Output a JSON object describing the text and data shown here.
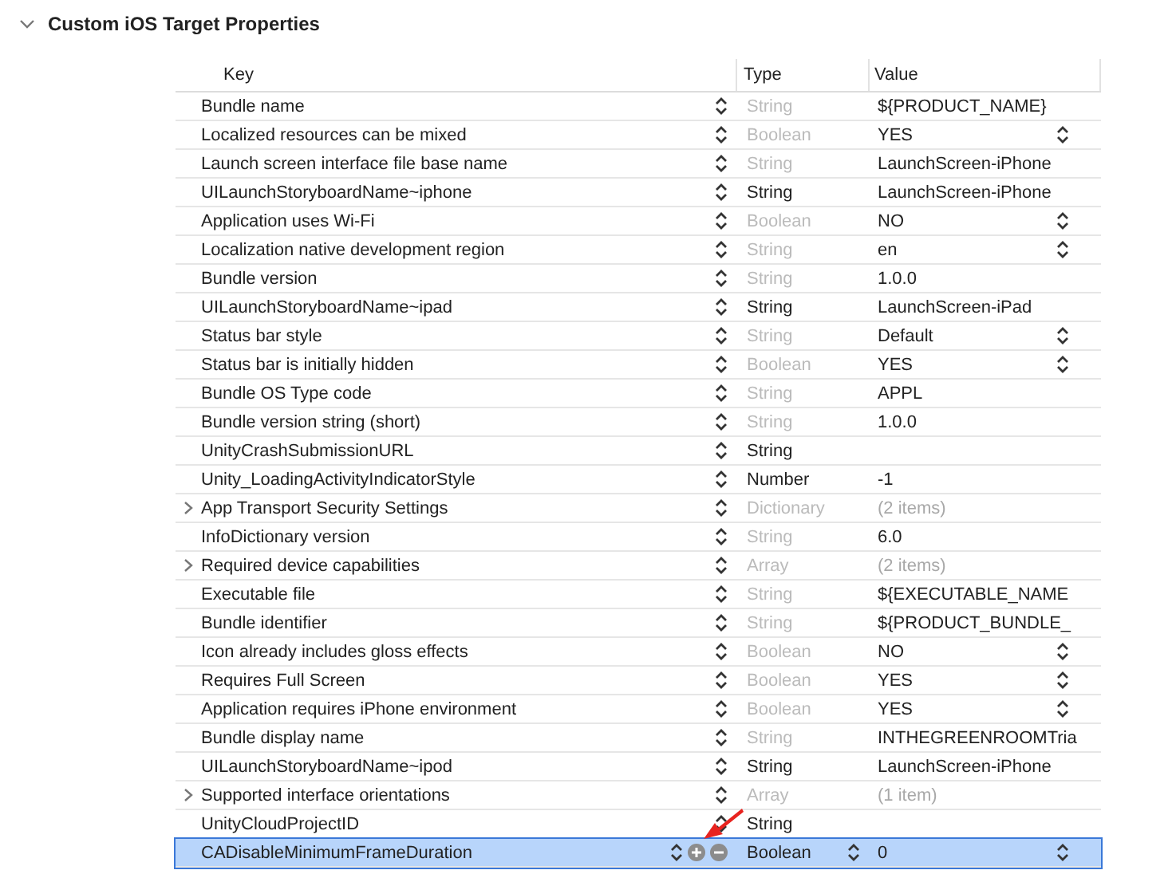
{
  "section": {
    "title": "Custom iOS Target Properties",
    "expanded": true
  },
  "columns": [
    "Key",
    "Type",
    "Value"
  ],
  "rows": [
    {
      "key": "Bundle name",
      "type": "String",
      "type_dimmed": true,
      "value": "${PRODUCT_NAME}",
      "value_dimmed": false,
      "value_popup": false,
      "expandable": false,
      "selected": false
    },
    {
      "key": "Localized resources can be mixed",
      "type": "Boolean",
      "type_dimmed": true,
      "value": "YES",
      "value_dimmed": false,
      "value_popup": true,
      "expandable": false,
      "selected": false
    },
    {
      "key": "Launch screen interface file base name",
      "type": "String",
      "type_dimmed": true,
      "value": "LaunchScreen-iPhone",
      "value_dimmed": false,
      "value_popup": false,
      "expandable": false,
      "selected": false
    },
    {
      "key": "UILaunchStoryboardName~iphone",
      "type": "String",
      "type_dimmed": false,
      "value": "LaunchScreen-iPhone",
      "value_dimmed": false,
      "value_popup": false,
      "expandable": false,
      "selected": false
    },
    {
      "key": "Application uses Wi-Fi",
      "type": "Boolean",
      "type_dimmed": true,
      "value": "NO",
      "value_dimmed": false,
      "value_popup": true,
      "expandable": false,
      "selected": false
    },
    {
      "key": "Localization native development region",
      "type": "String",
      "type_dimmed": true,
      "value": "en",
      "value_dimmed": false,
      "value_popup": true,
      "expandable": false,
      "selected": false
    },
    {
      "key": "Bundle version",
      "type": "String",
      "type_dimmed": true,
      "value": "1.0.0",
      "value_dimmed": false,
      "value_popup": false,
      "expandable": false,
      "selected": false
    },
    {
      "key": "UILaunchStoryboardName~ipad",
      "type": "String",
      "type_dimmed": false,
      "value": "LaunchScreen-iPad",
      "value_dimmed": false,
      "value_popup": false,
      "expandable": false,
      "selected": false
    },
    {
      "key": "Status bar style",
      "type": "String",
      "type_dimmed": true,
      "value": "Default",
      "value_dimmed": false,
      "value_popup": true,
      "expandable": false,
      "selected": false
    },
    {
      "key": "Status bar is initially hidden",
      "type": "Boolean",
      "type_dimmed": true,
      "value": "YES",
      "value_dimmed": false,
      "value_popup": true,
      "expandable": false,
      "selected": false
    },
    {
      "key": "Bundle OS Type code",
      "type": "String",
      "type_dimmed": true,
      "value": "APPL",
      "value_dimmed": false,
      "value_popup": false,
      "expandable": false,
      "selected": false
    },
    {
      "key": "Bundle version string (short)",
      "type": "String",
      "type_dimmed": true,
      "value": "1.0.0",
      "value_dimmed": false,
      "value_popup": false,
      "expandable": false,
      "selected": false
    },
    {
      "key": "UnityCrashSubmissionURL",
      "type": "String",
      "type_dimmed": false,
      "value_popup": false,
      "expandable": false,
      "selected": false
    },
    {
      "key": "Unity_LoadingActivityIndicatorStyle",
      "type": "Number",
      "type_dimmed": false,
      "value": "-1",
      "value_dimmed": false,
      "value_popup": false,
      "expandable": false,
      "selected": false
    },
    {
      "key": "App Transport Security Settings",
      "type": "Dictionary",
      "type_dimmed": true,
      "value": "(2 items)",
      "value_dimmed": true,
      "value_popup": false,
      "expandable": true,
      "selected": false
    },
    {
      "key": "InfoDictionary version",
      "type": "String",
      "type_dimmed": true,
      "value": "6.0",
      "value_dimmed": false,
      "value_popup": false,
      "expandable": false,
      "selected": false
    },
    {
      "key": "Required device capabilities",
      "type": "Array",
      "type_dimmed": true,
      "value": "(2 items)",
      "value_dimmed": true,
      "value_popup": false,
      "expandable": true,
      "selected": false
    },
    {
      "key": "Executable file",
      "type": "String",
      "type_dimmed": true,
      "value": "${EXECUTABLE_NAME",
      "value_dimmed": false,
      "value_popup": false,
      "expandable": false,
      "selected": false
    },
    {
      "key": "Bundle identifier",
      "type": "String",
      "type_dimmed": true,
      "value": "${PRODUCT_BUNDLE_",
      "value_dimmed": false,
      "value_popup": false,
      "expandable": false,
      "selected": false
    },
    {
      "key": "Icon already includes gloss effects",
      "type": "Boolean",
      "type_dimmed": true,
      "value": "NO",
      "value_dimmed": false,
      "value_popup": true,
      "expandable": false,
      "selected": false
    },
    {
      "key": "Requires Full Screen",
      "type": "Boolean",
      "type_dimmed": true,
      "value": "YES",
      "value_dimmed": false,
      "value_popup": true,
      "expandable": false,
      "selected": false
    },
    {
      "key": "Application requires iPhone environment",
      "type": "Boolean",
      "type_dimmed": true,
      "value": "YES",
      "value_dimmed": false,
      "value_popup": true,
      "expandable": false,
      "selected": false
    },
    {
      "key": "Bundle display name",
      "type": "String",
      "type_dimmed": true,
      "value": "INTHEGREENROOMTria",
      "value_dimmed": false,
      "value_popup": false,
      "expandable": false,
      "selected": false
    },
    {
      "key": "UILaunchStoryboardName~ipod",
      "type": "String",
      "type_dimmed": false,
      "value": "LaunchScreen-iPhone",
      "value_dimmed": false,
      "value_popup": false,
      "expandable": false,
      "selected": false
    },
    {
      "key": "Supported interface orientations",
      "type": "Array",
      "type_dimmed": true,
      "value": "(1 item)",
      "value_dimmed": true,
      "value_popup": false,
      "expandable": true,
      "selected": false
    },
    {
      "key": "UnityCloudProjectID",
      "type": "String",
      "type_dimmed": false,
      "value_popup": false,
      "expandable": false,
      "selected": false
    },
    {
      "key": "CADisableMinimumFrameDuration",
      "type": "Boolean",
      "type_dimmed": false,
      "value": "0",
      "value_dimmed": false,
      "value_popup": true,
      "expandable": false,
      "selected": true
    }
  ]
}
